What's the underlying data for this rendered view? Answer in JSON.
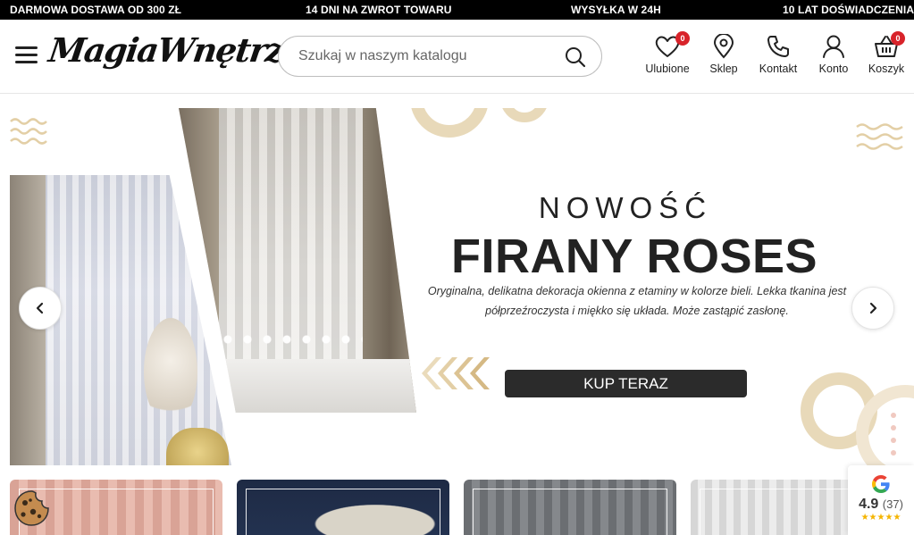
{
  "topbar": {
    "messages": [
      "DARMOWA DOSTAWA OD 300 ZŁ",
      "14 DNI NA ZWROT TOWARU",
      "WYSYŁKA W 24H",
      "10 LAT DOŚWIADCZENIA"
    ]
  },
  "header": {
    "logo": "MagiaWnętrz",
    "search_placeholder": "Szukaj w naszym katalogu",
    "icons": {
      "favorites": {
        "label": "Ulubione",
        "badge": "0"
      },
      "store": {
        "label": "Sklep"
      },
      "contact": {
        "label": "Kontakt"
      },
      "account": {
        "label": "Konto"
      },
      "cart": {
        "label": "Koszyk",
        "badge": "0"
      }
    }
  },
  "hero": {
    "eyebrow": "NOWOŚĆ",
    "headline": "FIRANY ROSES",
    "description": "Oryginalna, delikatna dekoracja okienna z etaminy w kolorze bieli. Lekka tkanina jest półprzeźroczysta i miękko się układa. Może zastąpić zasłonę.",
    "cta": "KUP TERAZ"
  },
  "reviews": {
    "score": "4.9",
    "count": "(37)",
    "stars": "★★★★★"
  },
  "colors": {
    "accent_gold": "#e8d9b9",
    "badge_red": "#d8232a",
    "cta_dark": "#2b2b2b"
  }
}
